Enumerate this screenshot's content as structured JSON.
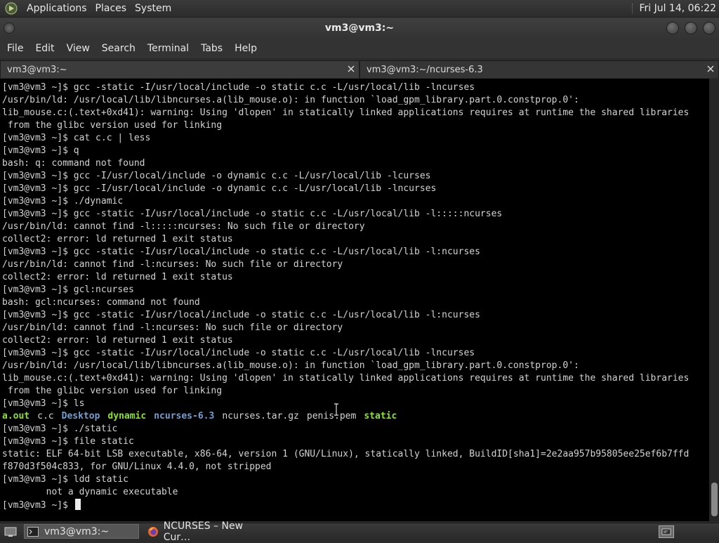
{
  "top_panel": {
    "menus": [
      "Applications",
      "Places",
      "System"
    ],
    "clock": "Fri Jul 14, 06:22"
  },
  "window": {
    "title": "vm3@vm3:~"
  },
  "menubar": {
    "items": [
      "File",
      "Edit",
      "View",
      "Search",
      "Terminal",
      "Tabs",
      "Help"
    ]
  },
  "tabs": [
    {
      "label": "vm3@vm3:~",
      "active": true
    },
    {
      "label": "vm3@vm3:~/ncurses-6.3",
      "active": false
    }
  ],
  "terminal": {
    "lines_before_ls": [
      "[vm3@vm3 ~]$ gcc -static -I/usr/local/include -o static c.c -L/usr/local/lib -lncurses",
      "/usr/bin/ld: /usr/local/lib/libncurses.a(lib_mouse.o): in function `load_gpm_library.part.0.constprop.0':",
      "lib_mouse.c:(.text+0xd41): warning: Using 'dlopen' in statically linked applications requires at runtime the shared libraries",
      " from the glibc version used for linking",
      "[vm3@vm3 ~]$ cat c.c | less",
      "[vm3@vm3 ~]$ q",
      "bash: q: command not found",
      "[vm3@vm3 ~]$ gcc -I/usr/local/include -o dynamic c.c -L/usr/local/lib -lcurses",
      "[vm3@vm3 ~]$ gcc -I/usr/local/include -o dynamic c.c -L/usr/local/lib -lncurses",
      "[vm3@vm3 ~]$ ./dynamic",
      "[vm3@vm3 ~]$ gcc -static -I/usr/local/include -o static c.c -L/usr/local/lib -l:::::ncurses",
      "/usr/bin/ld: cannot find -l:::::ncurses: No such file or directory",
      "collect2: error: ld returned 1 exit status",
      "[vm3@vm3 ~]$ gcc -static -I/usr/local/include -o static c.c -L/usr/local/lib -l:ncurses",
      "/usr/bin/ld: cannot find -l:ncurses: No such file or directory",
      "collect2: error: ld returned 1 exit status",
      "[vm3@vm3 ~]$ gcl:ncurses",
      "bash: gcl:ncurses: command not found",
      "[vm3@vm3 ~]$ gcc -static -I/usr/local/include -o static c.c -L/usr/local/lib -l:ncurses",
      "/usr/bin/ld: cannot find -l:ncurses: No such file or directory",
      "collect2: error: ld returned 1 exit status",
      "[vm3@vm3 ~]$ gcc -static -I/usr/local/include -o static c.c -L/usr/local/lib -lncurses",
      "/usr/bin/ld: /usr/local/lib/libncurses.a(lib_mouse.o): in function `load_gpm_library.part.0.constprop.0':",
      "lib_mouse.c:(.text+0xd41): warning: Using 'dlopen' in statically linked applications requires at runtime the shared libraries",
      " from the glibc version used for linking",
      "[vm3@vm3 ~]$ ls"
    ],
    "ls_output": [
      {
        "name": "a.out",
        "kind": "exec"
      },
      {
        "name": "c.c",
        "kind": "file"
      },
      {
        "name": "Desktop",
        "kind": "dir"
      },
      {
        "name": "dynamic",
        "kind": "exec"
      },
      {
        "name": "ncurses-6.3",
        "kind": "dir"
      },
      {
        "name": "ncurses.tar.gz",
        "kind": "file"
      },
      {
        "name": "penis.pem",
        "kind": "file"
      },
      {
        "name": "static",
        "kind": "exec"
      }
    ],
    "lines_after_ls": [
      "[vm3@vm3 ~]$ ./static",
      "[vm3@vm3 ~]$ file static",
      "static: ELF 64-bit LSB executable, x86-64, version 1 (GNU/Linux), statically linked, BuildID[sha1]=2e2aa957b95805ee25ef6b7ffd",
      "f870d3f504c833, for GNU/Linux 4.4.0, not stripped",
      "[vm3@vm3 ~]$ ldd static",
      "        not a dynamic executable"
    ],
    "prompt": "[vm3@vm3 ~]$ "
  },
  "taskbar": {
    "tasks": [
      {
        "label": "vm3@vm3:~",
        "active": true
      },
      {
        "label": "NCURSES – New Cur…",
        "active": false
      }
    ]
  },
  "colors": {
    "exec": "#8ae234",
    "dir": "#729fcf",
    "terminal_bg": "#000000",
    "terminal_fg": "#d3d3d3"
  }
}
